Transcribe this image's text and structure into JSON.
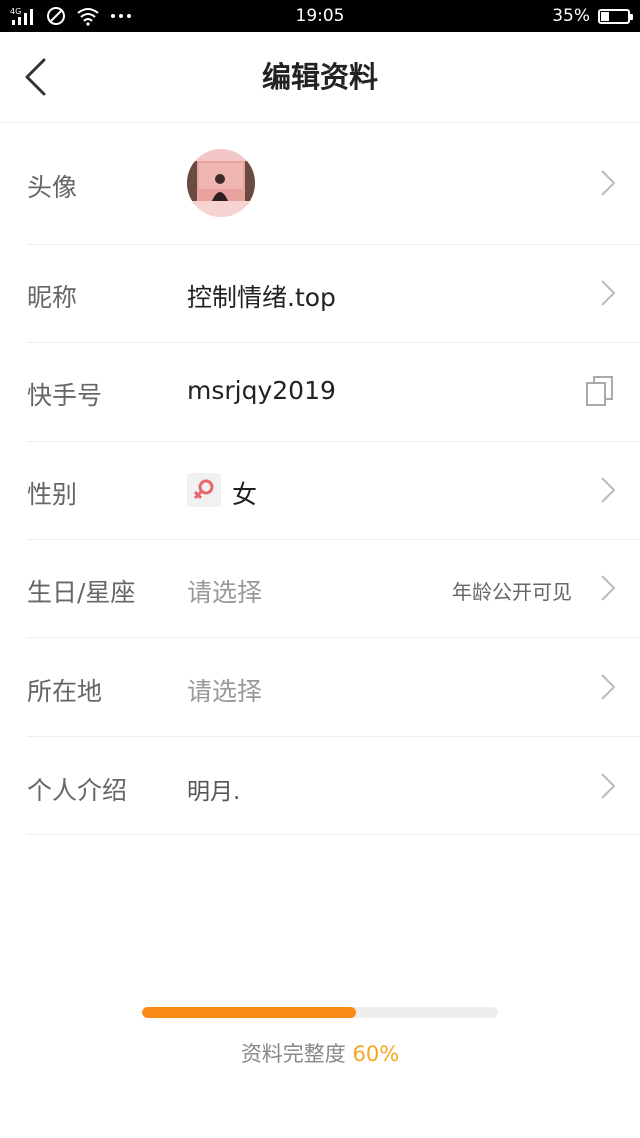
{
  "status_bar": {
    "network": "4G",
    "time": "19:05",
    "battery": "35%",
    "battery_level": 0.35
  },
  "header": {
    "title": "编辑资料"
  },
  "rows": [
    {
      "label": "头像"
    },
    {
      "label": "昵称",
      "value": "控制情绪.top"
    },
    {
      "label": "快手号",
      "value": "msrjqy2019"
    },
    {
      "label": "性别",
      "value": "女"
    },
    {
      "label": "生日/星座",
      "value": "请选择",
      "hint": "年龄公开可见"
    },
    {
      "label": "所在地",
      "value": "请选择"
    },
    {
      "label": "个人介绍",
      "value": "明月."
    }
  ],
  "completeness": {
    "label": "资料完整度",
    "percent_text": "60%",
    "value": 0.6
  },
  "colors": {
    "accent": "#fb8a14",
    "percent": "#f6a623",
    "female_icon": "#e8676b"
  },
  "icons": [
    "signal-icon",
    "no-disturb-icon",
    "wifi-icon",
    "more-dots-icon",
    "back-icon",
    "chevron-right-icon",
    "copy-icon",
    "female-icon"
  ]
}
